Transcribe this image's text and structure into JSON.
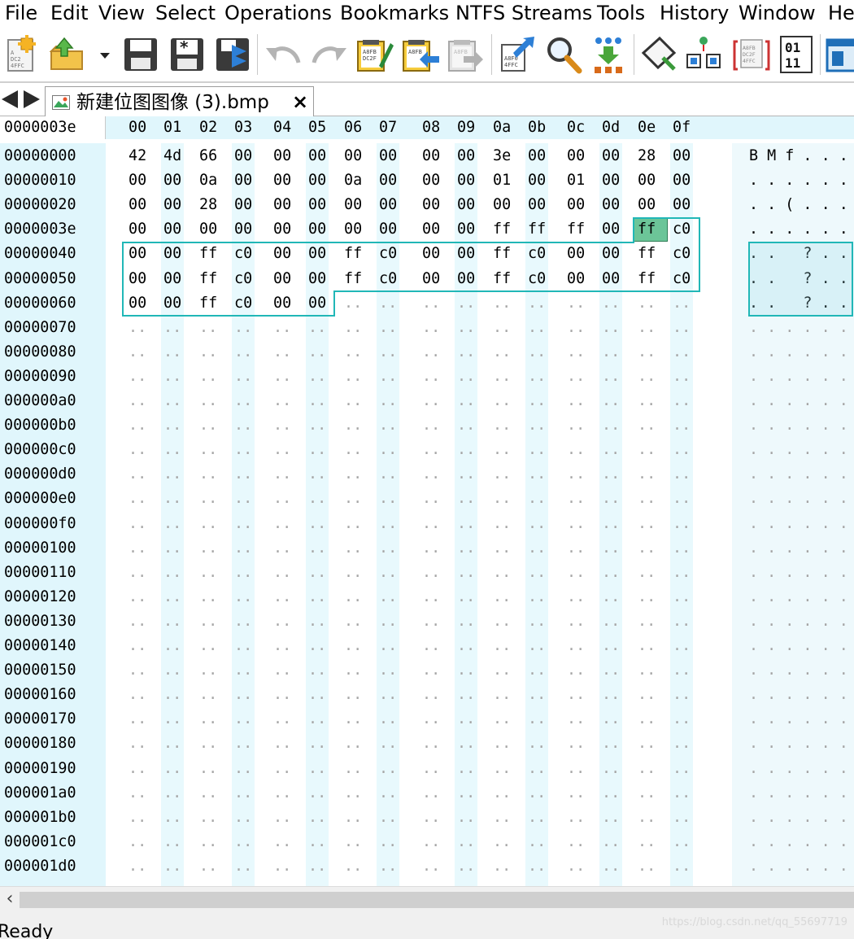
{
  "menu": [
    {
      "id": "file",
      "label": "File"
    },
    {
      "id": "edit",
      "label": "Edit"
    },
    {
      "id": "view",
      "label": "View"
    },
    {
      "id": "select",
      "label": "Select"
    },
    {
      "id": "operations",
      "label": "Operations"
    },
    {
      "id": "bookmarks",
      "label": "Bookmarks"
    },
    {
      "id": "ntfs-streams",
      "label": "NTFS Streams"
    },
    {
      "id": "tools",
      "label": "Tools"
    },
    {
      "id": "history",
      "label": "History"
    },
    {
      "id": "window",
      "label": "Window"
    },
    {
      "id": "help",
      "label": "He"
    }
  ],
  "toolbar": {
    "icons": [
      "new-file-icon",
      "open-folder-icon",
      "dropdown-arrow-icon",
      "save-icon",
      "save-as-icon",
      "save-all-icon",
      "undo-icon",
      "redo-icon",
      "copy-hex-icon",
      "paste-icon",
      "paste-special-icon",
      "goto-icon",
      "find-icon",
      "find-next-icon",
      "fill-icon",
      "compare-icon",
      "compute-icon",
      "binary-icon",
      "panel-icon"
    ],
    "binary_label_top": "01",
    "binary_label_bottom": "11",
    "chip_text": "A8FB DC2F 4FFC"
  },
  "tab": {
    "title": "新建位图图像 (3).bmp",
    "close_label": "×"
  },
  "hexview": {
    "current_offset": "0000003e",
    "columns": [
      "00",
      "01",
      "02",
      "03",
      "04",
      "05",
      "06",
      "07",
      "08",
      "09",
      "0a",
      "0b",
      "0c",
      "0d",
      "0e",
      "0f"
    ],
    "rows": [
      {
        "offset": "00000000",
        "bytes": [
          "42",
          "4d",
          "66",
          "00",
          "00",
          "00",
          "00",
          "00",
          "00",
          "00",
          "3e",
          "00",
          "00",
          "00",
          "28",
          "00"
        ],
        "ascii": "B M f . . ."
      },
      {
        "offset": "00000010",
        "bytes": [
          "00",
          "00",
          "0a",
          "00",
          "00",
          "00",
          "0a",
          "00",
          "00",
          "00",
          "01",
          "00",
          "01",
          "00",
          "00",
          "00"
        ],
        "ascii": ". . . . . ."
      },
      {
        "offset": "00000020",
        "bytes": [
          "00",
          "00",
          "28",
          "00",
          "00",
          "00",
          "00",
          "00",
          "00",
          "00",
          "00",
          "00",
          "00",
          "00",
          "00",
          "00"
        ],
        "ascii": ". . ( . . ."
      },
      {
        "offset": "0000003e",
        "bytes": [
          "00",
          "00",
          "00",
          "00",
          "00",
          "00",
          "00",
          "00",
          "00",
          "00",
          "ff",
          "ff",
          "ff",
          "00",
          "ff",
          "c0"
        ],
        "ascii": ". . . . . ."
      },
      {
        "offset": "00000040",
        "bytes": [
          "00",
          "00",
          "ff",
          "c0",
          "00",
          "00",
          "ff",
          "c0",
          "00",
          "00",
          "ff",
          "c0",
          "00",
          "00",
          "ff",
          "c0"
        ],
        "ascii": ". .   ? . ."
      },
      {
        "offset": "00000050",
        "bytes": [
          "00",
          "00",
          "ff",
          "c0",
          "00",
          "00",
          "ff",
          "c0",
          "00",
          "00",
          "ff",
          "c0",
          "00",
          "00",
          "ff",
          "c0"
        ],
        "ascii": ". .   ? . ."
      },
      {
        "offset": "00000060",
        "bytes": [
          "00",
          "00",
          "ff",
          "c0",
          "00",
          "00",
          "..",
          "..",
          "..",
          "..",
          "..",
          "..",
          "..",
          "..",
          "..",
          ".."
        ],
        "ascii": ". .   ? . ."
      },
      {
        "offset": "00000070",
        "bytes": [
          "..",
          "..",
          "..",
          "..",
          "..",
          "..",
          "..",
          "..",
          "..",
          "..",
          "..",
          "..",
          "..",
          "..",
          "..",
          ".."
        ],
        "ascii": ". . . . . ."
      },
      {
        "offset": "00000080",
        "bytes": [
          "..",
          "..",
          "..",
          "..",
          "..",
          "..",
          "..",
          "..",
          "..",
          "..",
          "..",
          "..",
          "..",
          "..",
          "..",
          ".."
        ],
        "ascii": ". . . . . ."
      },
      {
        "offset": "00000090",
        "bytes": [
          "..",
          "..",
          "..",
          "..",
          "..",
          "..",
          "..",
          "..",
          "..",
          "..",
          "..",
          "..",
          "..",
          "..",
          "..",
          ".."
        ],
        "ascii": ". . . . . ."
      },
      {
        "offset": "000000a0",
        "bytes": [
          "..",
          "..",
          "..",
          "..",
          "..",
          "..",
          "..",
          "..",
          "..",
          "..",
          "..",
          "..",
          "..",
          "..",
          "..",
          ".."
        ],
        "ascii": ". . . . . ."
      },
      {
        "offset": "000000b0",
        "bytes": [
          "..",
          "..",
          "..",
          "..",
          "..",
          "..",
          "..",
          "..",
          "..",
          "..",
          "..",
          "..",
          "..",
          "..",
          "..",
          ".."
        ],
        "ascii": ". . . . . ."
      },
      {
        "offset": "000000c0",
        "bytes": [
          "..",
          "..",
          "..",
          "..",
          "..",
          "..",
          "..",
          "..",
          "..",
          "..",
          "..",
          "..",
          "..",
          "..",
          "..",
          ".."
        ],
        "ascii": ". . . . . ."
      },
      {
        "offset": "000000d0",
        "bytes": [
          "..",
          "..",
          "..",
          "..",
          "..",
          "..",
          "..",
          "..",
          "..",
          "..",
          "..",
          "..",
          "..",
          "..",
          "..",
          ".."
        ],
        "ascii": ". . . . . ."
      },
      {
        "offset": "000000e0",
        "bytes": [
          "..",
          "..",
          "..",
          "..",
          "..",
          "..",
          "..",
          "..",
          "..",
          "..",
          "..",
          "..",
          "..",
          "..",
          "..",
          ".."
        ],
        "ascii": ". . . . . ."
      },
      {
        "offset": "000000f0",
        "bytes": [
          "..",
          "..",
          "..",
          "..",
          "..",
          "..",
          "..",
          "..",
          "..",
          "..",
          "..",
          "..",
          "..",
          "..",
          "..",
          ".."
        ],
        "ascii": ". . . . . ."
      },
      {
        "offset": "00000100",
        "bytes": [
          "..",
          "..",
          "..",
          "..",
          "..",
          "..",
          "..",
          "..",
          "..",
          "..",
          "..",
          "..",
          "..",
          "..",
          "..",
          ".."
        ],
        "ascii": ". . . . . ."
      },
      {
        "offset": "00000110",
        "bytes": [
          "..",
          "..",
          "..",
          "..",
          "..",
          "..",
          "..",
          "..",
          "..",
          "..",
          "..",
          "..",
          "..",
          "..",
          "..",
          ".."
        ],
        "ascii": ". . . . . ."
      },
      {
        "offset": "00000120",
        "bytes": [
          "..",
          "..",
          "..",
          "..",
          "..",
          "..",
          "..",
          "..",
          "..",
          "..",
          "..",
          "..",
          "..",
          "..",
          "..",
          ".."
        ],
        "ascii": ". . . . . ."
      },
      {
        "offset": "00000130",
        "bytes": [
          "..",
          "..",
          "..",
          "..",
          "..",
          "..",
          "..",
          "..",
          "..",
          "..",
          "..",
          "..",
          "..",
          "..",
          "..",
          ".."
        ],
        "ascii": ". . . . . ."
      },
      {
        "offset": "00000140",
        "bytes": [
          "..",
          "..",
          "..",
          "..",
          "..",
          "..",
          "..",
          "..",
          "..",
          "..",
          "..",
          "..",
          "..",
          "..",
          "..",
          ".."
        ],
        "ascii": ". . . . . ."
      },
      {
        "offset": "00000150",
        "bytes": [
          "..",
          "..",
          "..",
          "..",
          "..",
          "..",
          "..",
          "..",
          "..",
          "..",
          "..",
          "..",
          "..",
          "..",
          "..",
          ".."
        ],
        "ascii": ". . . . . ."
      },
      {
        "offset": "00000160",
        "bytes": [
          "..",
          "..",
          "..",
          "..",
          "..",
          "..",
          "..",
          "..",
          "..",
          "..",
          "..",
          "..",
          "..",
          "..",
          "..",
          ".."
        ],
        "ascii": ". . . . . ."
      },
      {
        "offset": "00000170",
        "bytes": [
          "..",
          "..",
          "..",
          "..",
          "..",
          "..",
          "..",
          "..",
          "..",
          "..",
          "..",
          "..",
          "..",
          "..",
          "..",
          ".."
        ],
        "ascii": ". . . . . ."
      },
      {
        "offset": "00000180",
        "bytes": [
          "..",
          "..",
          "..",
          "..",
          "..",
          "..",
          "..",
          "..",
          "..",
          "..",
          "..",
          "..",
          "..",
          "..",
          "..",
          ".."
        ],
        "ascii": ". . . . . ."
      },
      {
        "offset": "00000190",
        "bytes": [
          "..",
          "..",
          "..",
          "..",
          "..",
          "..",
          "..",
          "..",
          "..",
          "..",
          "..",
          "..",
          "..",
          "..",
          "..",
          ".."
        ],
        "ascii": ". . . . . ."
      },
      {
        "offset": "000001a0",
        "bytes": [
          "..",
          "..",
          "..",
          "..",
          "..",
          "..",
          "..",
          "..",
          "..",
          "..",
          "..",
          "..",
          "..",
          "..",
          "..",
          ".."
        ],
        "ascii": ". . . . . ."
      },
      {
        "offset": "000001b0",
        "bytes": [
          "..",
          "..",
          "..",
          "..",
          "..",
          "..",
          "..",
          "..",
          "..",
          "..",
          "..",
          "..",
          "..",
          "..",
          "..",
          ".."
        ],
        "ascii": ". . . . . ."
      },
      {
        "offset": "000001c0",
        "bytes": [
          "..",
          "..",
          "..",
          "..",
          "..",
          "..",
          "..",
          "..",
          "..",
          "..",
          "..",
          "..",
          "..",
          "..",
          "..",
          ".."
        ],
        "ascii": ". . . . . ."
      },
      {
        "offset": "000001d0",
        "bytes": [
          "..",
          "..",
          "..",
          "..",
          "..",
          "..",
          "..",
          "..",
          "..",
          "..",
          "..",
          "..",
          "..",
          "..",
          "..",
          ".."
        ],
        "ascii": ". . . . . ."
      }
    ],
    "cursor_byte": "ff",
    "selection_color": "#21b7b7",
    "cursor_color": "#6cc598"
  },
  "statusbar": {
    "text": "Ready",
    "watermark": "https://blog.csdn.net/qq_55697719"
  }
}
